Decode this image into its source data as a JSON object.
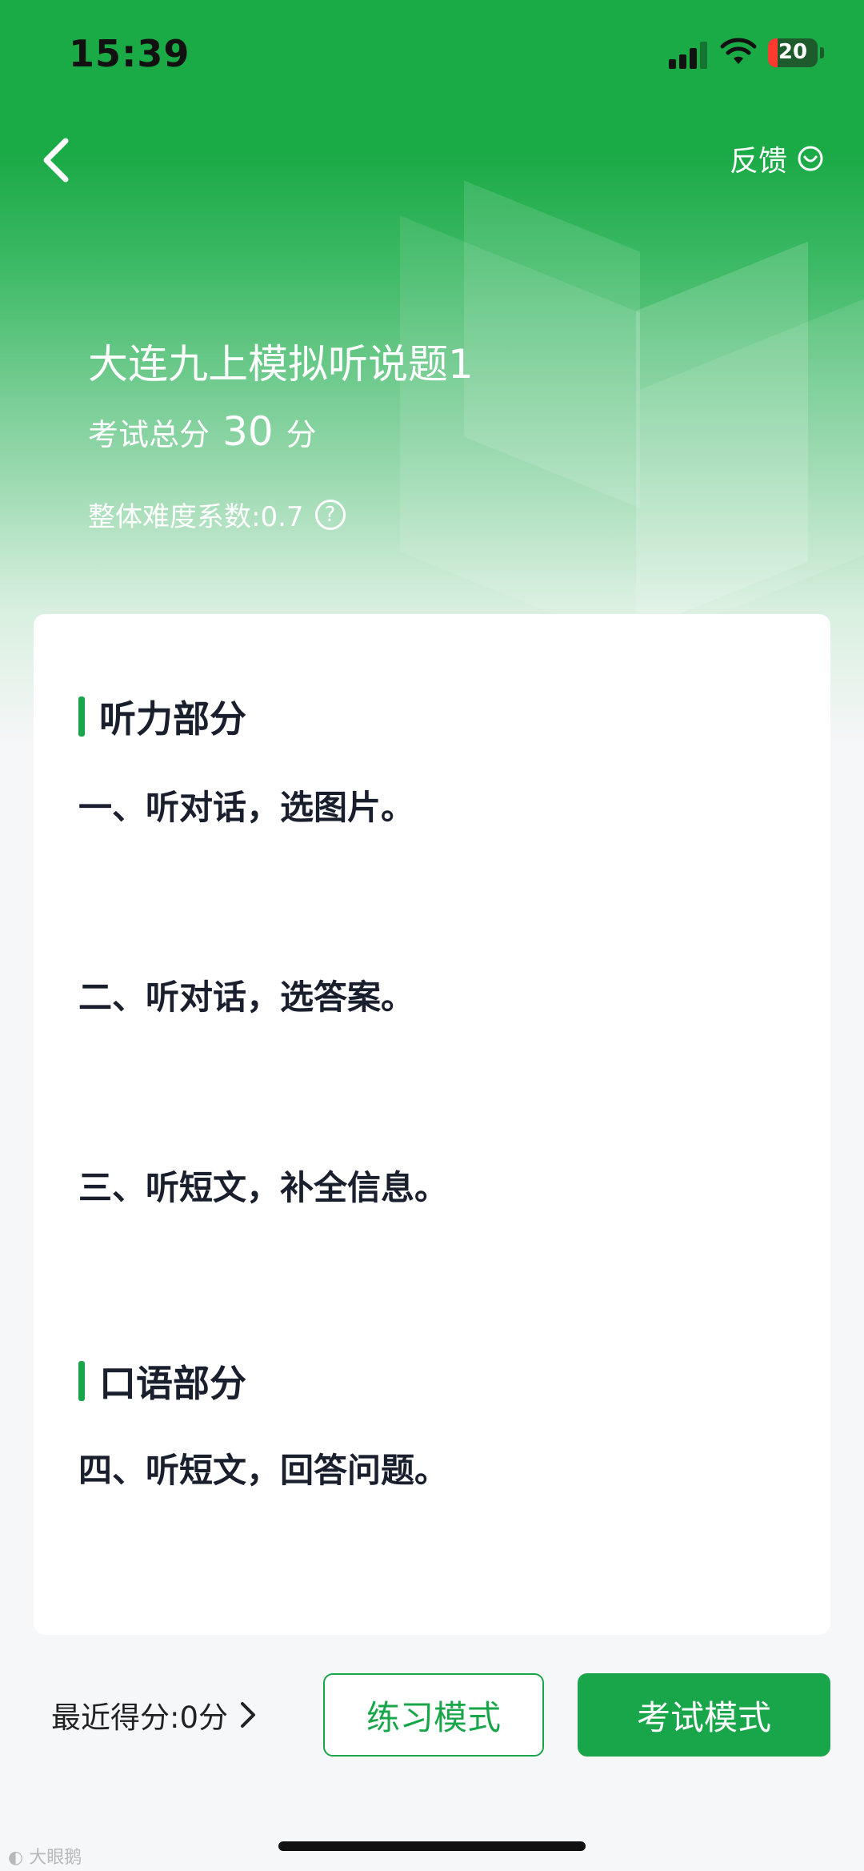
{
  "status_bar": {
    "time": "15:39",
    "battery": "20"
  },
  "nav": {
    "back_icon": "chevron-left-icon",
    "feedback_label": "反馈",
    "feedback_icon": "smile-circle-icon"
  },
  "exam": {
    "title": "大连九上模拟听说题1",
    "score_prefix": "考试总分",
    "score_value": "30",
    "score_suffix": "分",
    "difficulty_label": "整体难度系数:0.7",
    "difficulty_help_icon": "question-circle-icon"
  },
  "sections": [
    {
      "heading": "听力部分",
      "items": [
        "一、听对话，选图片。",
        "二、听对话，选答案。",
        "三、听短文，补全信息。"
      ]
    },
    {
      "heading": "口语部分",
      "items": [
        "四、听短文，回答问题。"
      ]
    }
  ],
  "footer": {
    "recent_score": "最近得分:0分",
    "practice_button": "练习模式",
    "exam_button": "考试模式"
  },
  "colors": {
    "brand_green": "#19a64a",
    "text_dark": "#1a1f2e"
  }
}
